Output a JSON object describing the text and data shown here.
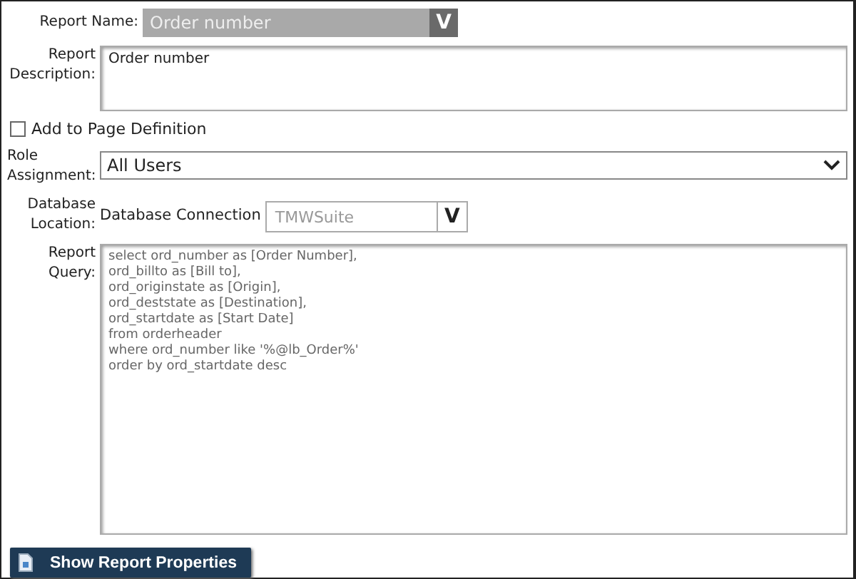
{
  "report_name": {
    "label": "Report Name:",
    "value": "Order number",
    "dropdown_glyph": "V"
  },
  "report_description": {
    "label_lines": [
      "Report",
      "Description:"
    ],
    "value": "Order number"
  },
  "add_to_page_definition": {
    "label": "Add to Page Definition",
    "checked": false
  },
  "role_assignment": {
    "label_lines": [
      "Role",
      "Assignment:"
    ],
    "value": "All Users"
  },
  "database_location": {
    "label_lines": [
      "Database",
      "Location:"
    ],
    "connection_label": "Database Connection",
    "value": "TMWSuite",
    "dropdown_glyph": "V"
  },
  "report_query": {
    "label_lines": [
      "Report",
      "Query:"
    ],
    "lines": [
      "select ord_number as [Order Number],",
      "ord_billto as [Bill to],",
      "ord_originstate as [Origin],",
      "ord_deststate as [Destination],",
      "ord_startdate as [Start Date]",
      "from orderheader",
      "where ord_number like '%@lb_Order%'",
      "order by ord_startdate desc"
    ]
  },
  "show_properties_button": {
    "label": "Show Report Properties"
  }
}
